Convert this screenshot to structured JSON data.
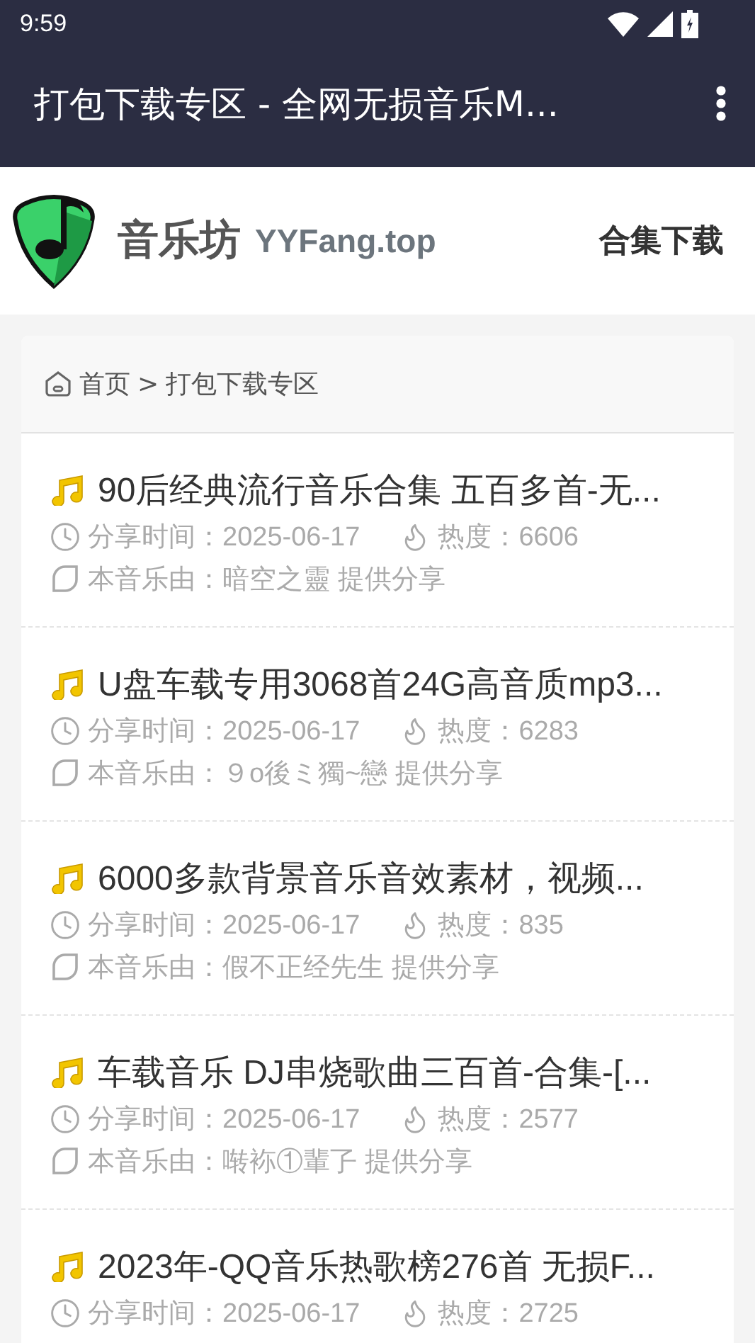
{
  "status_bar": {
    "time": "9:59"
  },
  "app_bar": {
    "title": "打包下载专区 - 全网无损音乐M..."
  },
  "site_header": {
    "name": "音乐坊",
    "domain": "YYFang.top",
    "nav_link": "合集下载"
  },
  "breadcrumb": {
    "home": "首页",
    "separator": ">",
    "current": "打包下载专区"
  },
  "items": [
    {
      "title": "90后经典流行音乐合集 五百多首-无...",
      "time": "分享时间：2025-06-17",
      "heat": "热度：6606",
      "provider": "本音乐由：暗空之靈 提供分享"
    },
    {
      "title": "U盘车载专用3068首24G高音质mp3...",
      "time": "分享时间：2025-06-17",
      "heat": "热度：6283",
      "provider": "本音乐由：９o後ミ獨~戀 提供分享"
    },
    {
      "title": "6000多款背景音乐音效素材，视频...",
      "time": "分享时间：2025-06-17",
      "heat": "热度：835",
      "provider": "本音乐由：假不正经先生 提供分享"
    },
    {
      "title": "车载音乐 DJ串烧歌曲三百首-合集-[...",
      "time": "分享时间：2025-06-17",
      "heat": "热度：2577",
      "provider": "本音乐由：啭袮①輩孒 提供分享"
    },
    {
      "title": "2023年-QQ音乐热歌榜276首 无损F...",
      "time": "分享时间：2025-06-17",
      "heat": "热度：2725"
    }
  ]
}
